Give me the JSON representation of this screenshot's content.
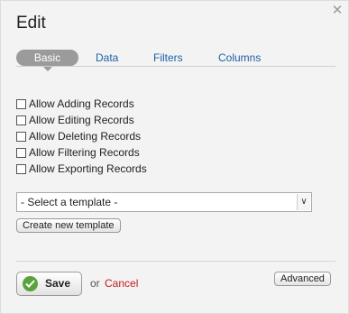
{
  "dialog": {
    "title": "Edit",
    "close_icon": "close-icon"
  },
  "tabs": [
    {
      "label": "Basic",
      "active": true
    },
    {
      "label": "Data",
      "active": false
    },
    {
      "label": "Filters",
      "active": false
    },
    {
      "label": "Columns",
      "active": false
    }
  ],
  "options": [
    {
      "label": "Allow Adding Records",
      "checked": false
    },
    {
      "label": "Allow Editing Records",
      "checked": false
    },
    {
      "label": "Allow Deleting Records",
      "checked": false
    },
    {
      "label": "Allow Filtering Records",
      "checked": false
    },
    {
      "label": "Allow Exporting Records",
      "checked": false
    }
  ],
  "template": {
    "selected": "- Select a template -",
    "create_label": "Create new template"
  },
  "footer": {
    "save_label": "Save",
    "or_text": "or",
    "cancel_label": "Cancel",
    "advanced_label": "Advanced"
  },
  "colors": {
    "active_tab": "#9b9b9b",
    "link": "#1f5fa8",
    "cancel": "#c21c1c",
    "save_icon": "#58a33a"
  }
}
